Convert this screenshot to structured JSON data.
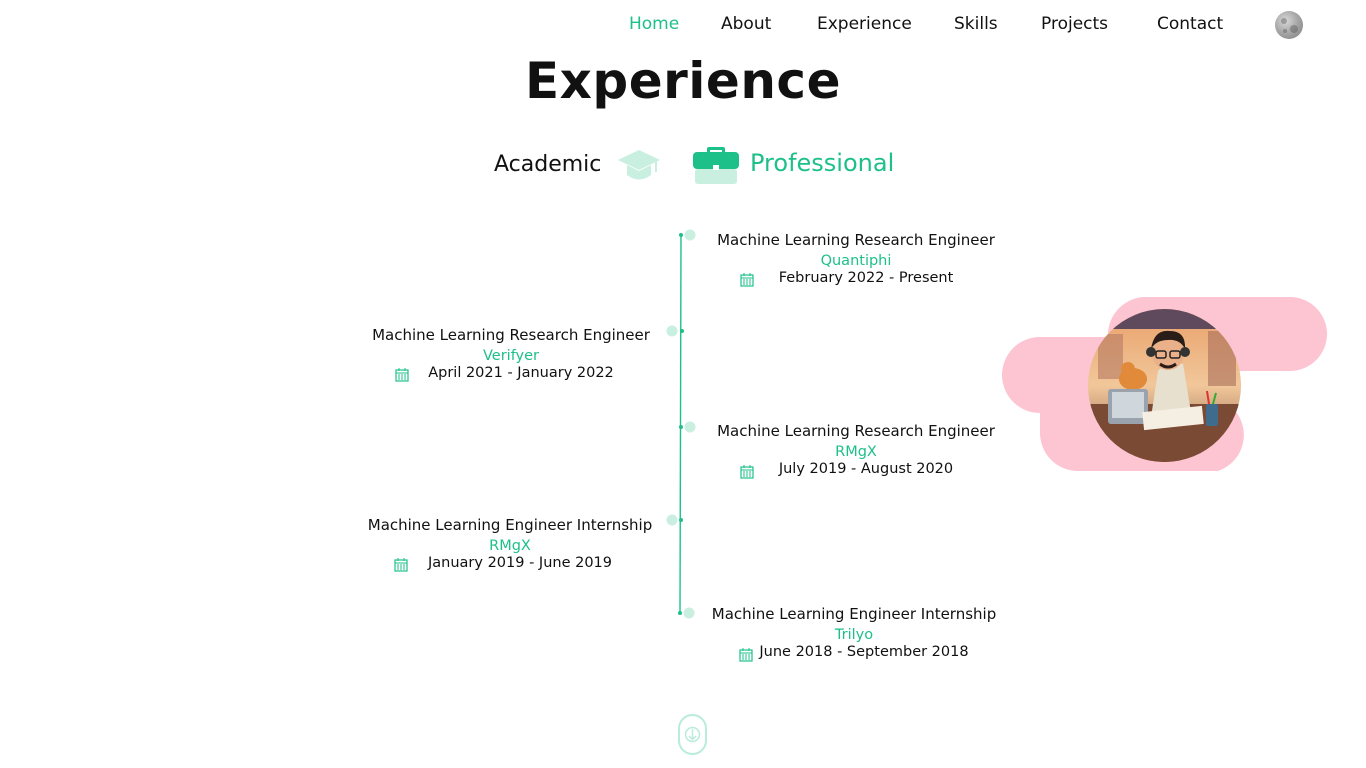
{
  "nav": {
    "items": [
      {
        "label": "Home",
        "active": true
      },
      {
        "label": "About"
      },
      {
        "label": "Experience"
      },
      {
        "label": "Skills"
      },
      {
        "label": "Projects"
      },
      {
        "label": "Contact"
      }
    ],
    "theme_toggle_icon": "moon-icon"
  },
  "section": {
    "title": "Experience",
    "tabs": [
      {
        "label": "Academic",
        "icon": "graduation-cap-icon"
      },
      {
        "label": "Professional",
        "icon": "briefcase-icon",
        "active": true
      }
    ]
  },
  "timeline": [
    {
      "role": "Machine Learning Research Engineer",
      "company": "Quantiphi",
      "date": "February 2022 - Present",
      "side": "right"
    },
    {
      "role": "Machine Learning Research Engineer",
      "company": "Verifyer",
      "date": "April 2021 - January 2022",
      "side": "left"
    },
    {
      "role": "Machine Learning Research Engineer",
      "company": "RMgX",
      "date": "July 2019 - August 2020",
      "side": "right"
    },
    {
      "role": "Machine Learning Engineer Internship",
      "company": "RMgX",
      "date": "January 2019 - June 2019",
      "side": "left"
    },
    {
      "role": "Machine Learning Engineer Internship",
      "company": "Trilyo",
      "date": "June 2018 - September 2018",
      "side": "right"
    }
  ],
  "colors": {
    "accent": "#1ec08a",
    "accent_light": "#c8efe0",
    "blob": "#fdc4d2"
  },
  "scroll_icon": "arrow-down-icon"
}
